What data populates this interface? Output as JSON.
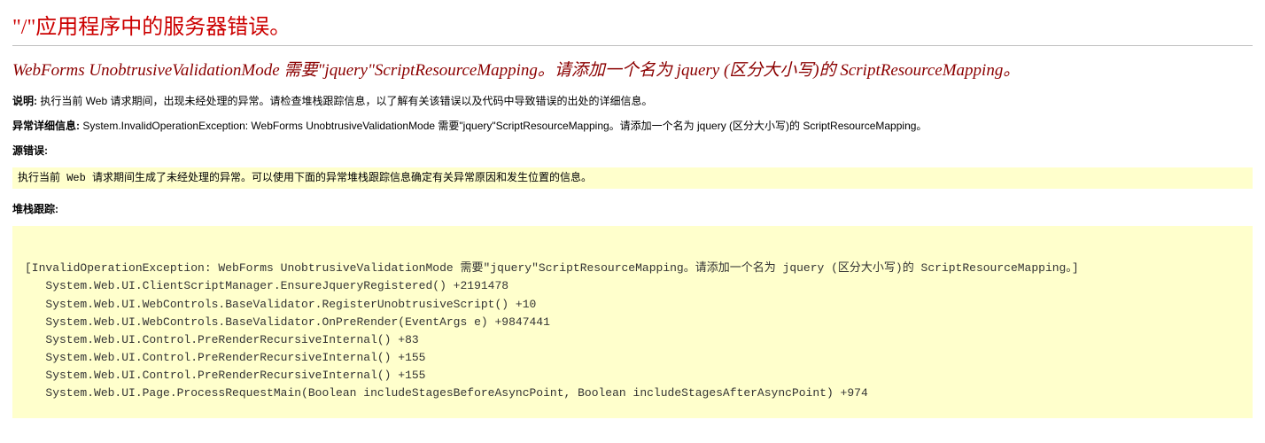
{
  "title": "\"/\"应用程序中的服务器错误。",
  "subtitle": "WebForms UnobtrusiveValidationMode 需要\"jquery\"ScriptResourceMapping。请添加一个名为 jquery (区分大小写)的 ScriptResourceMapping。",
  "desc_label": "说明:",
  "desc_text": " 执行当前 Web 请求期间，出现未经处理的异常。请检查堆栈跟踪信息，以了解有关该错误以及代码中导致错误的出处的详细信息。",
  "exc_label": "异常详细信息:",
  "exc_text": " System.InvalidOperationException: WebForms UnobtrusiveValidationMode 需要\"jquery\"ScriptResourceMapping。请添加一个名为 jquery (区分大小写)的 ScriptResourceMapping。",
  "src_label": "源错误:",
  "src_code": "执行当前 Web 请求期间生成了未经处理的异常。可以使用下面的异常堆栈跟踪信息确定有关异常原因和发生位置的信息。",
  "trace_label": "堆栈跟踪:",
  "trace_code": "\n[InvalidOperationException: WebForms UnobtrusiveValidationMode 需要\"jquery\"ScriptResourceMapping。请添加一个名为 jquery (区分大小写)的 ScriptResourceMapping。]\n   System.Web.UI.ClientScriptManager.EnsureJqueryRegistered() +2191478\n   System.Web.UI.WebControls.BaseValidator.RegisterUnobtrusiveScript() +10\n   System.Web.UI.WebControls.BaseValidator.OnPreRender(EventArgs e) +9847441\n   System.Web.UI.Control.PreRenderRecursiveInternal() +83\n   System.Web.UI.Control.PreRenderRecursiveInternal() +155\n   System.Web.UI.Control.PreRenderRecursiveInternal() +155\n   System.Web.UI.Page.ProcessRequestMain(Boolean includeStagesBeforeAsyncPoint, Boolean includeStagesAfterAsyncPoint) +974\n"
}
